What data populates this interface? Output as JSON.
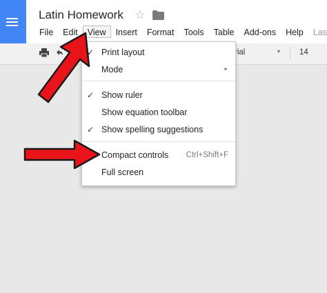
{
  "doc": {
    "title": "Latin Homework",
    "star_glyph": "☆"
  },
  "menubar": {
    "items": [
      {
        "label": "File"
      },
      {
        "label": "Edit"
      },
      {
        "label": "View"
      },
      {
        "label": "Insert"
      },
      {
        "label": "Format"
      },
      {
        "label": "Tools"
      },
      {
        "label": "Table"
      },
      {
        "label": "Add-ons"
      },
      {
        "label": "Help"
      },
      {
        "label": "Las"
      }
    ],
    "active": "View"
  },
  "toolbar": {
    "font_name": "rial",
    "font_caret": "▾",
    "font_size": "14"
  },
  "view_menu": {
    "items": [
      {
        "label": "Print layout",
        "checked": true,
        "check_glyph": "✓",
        "shortcut": "",
        "submenu": false
      },
      {
        "label": "Mode",
        "checked": false,
        "check_glyph": "",
        "shortcut": "",
        "submenu": true,
        "submenu_glyph": "►"
      },
      {
        "label": "Show ruler",
        "checked": true,
        "check_glyph": "✓",
        "shortcut": "",
        "submenu": false
      },
      {
        "label": "Show equation toolbar",
        "checked": false,
        "check_glyph": "",
        "shortcut": "",
        "submenu": false
      },
      {
        "label": "Show spelling suggestions",
        "checked": true,
        "check_glyph": "✓",
        "shortcut": "",
        "submenu": false
      },
      {
        "label": "Compact controls",
        "checked": false,
        "check_glyph": "",
        "shortcut": "Ctrl+Shift+F",
        "submenu": false
      },
      {
        "label": "Full screen",
        "checked": false,
        "check_glyph": "",
        "shortcut": "",
        "submenu": false
      }
    ]
  },
  "colors": {
    "brand_blue": "#4285f4",
    "annotation_arrow_red": "#e8141a"
  },
  "icons": [
    "docs-logo-icon",
    "star-icon",
    "folder-icon",
    "print-icon",
    "undo-icon",
    "chevron-right-icon",
    "checkmark-icon"
  ]
}
